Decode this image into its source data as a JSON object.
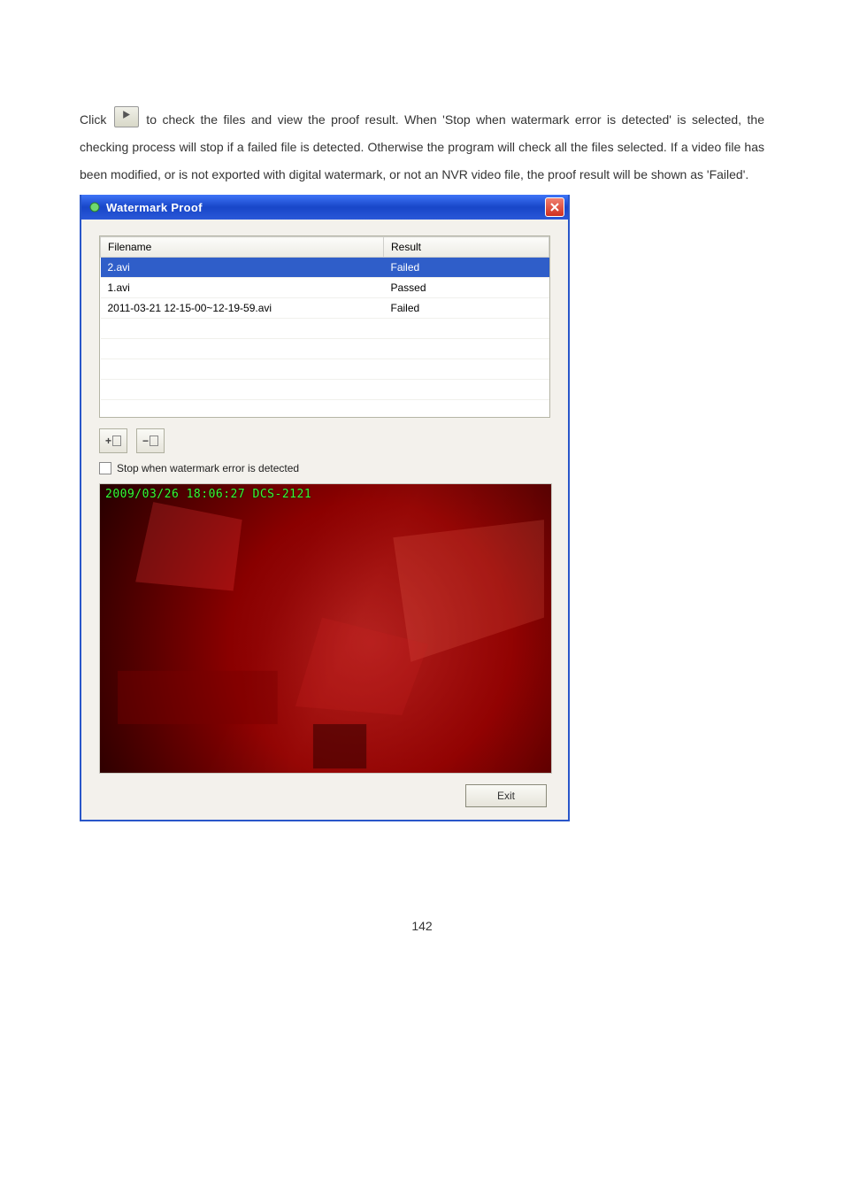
{
  "para": {
    "pre": "Click ",
    "post": " to check the files and view the proof result.   When 'Stop when watermark error is detected' is selected, the checking process will stop if a failed file is detected.   Otherwise the program will check all the files selected.   If a video file has been modified, or is not exported with digital watermark, or not an NVR video file, the proof result will be shown as 'Failed'."
  },
  "window": {
    "title": "Watermark Proof",
    "columns": {
      "filename": "Filename",
      "result": "Result"
    },
    "rows": [
      {
        "filename": "2.avi",
        "result": "Failed",
        "selected": true
      },
      {
        "filename": "1.avi",
        "result": "Passed",
        "selected": false
      },
      {
        "filename": "2011-03-21 12-15-00~12-19-59.avi",
        "result": "Failed",
        "selected": false
      }
    ],
    "add_label": "+",
    "remove_label": "−",
    "checkbox_label": "Stop when watermark error is detected",
    "preview_timestamp": "2009/03/26 18:06:27 DCS-2121",
    "exit_label": "Exit"
  },
  "page_number": "142"
}
